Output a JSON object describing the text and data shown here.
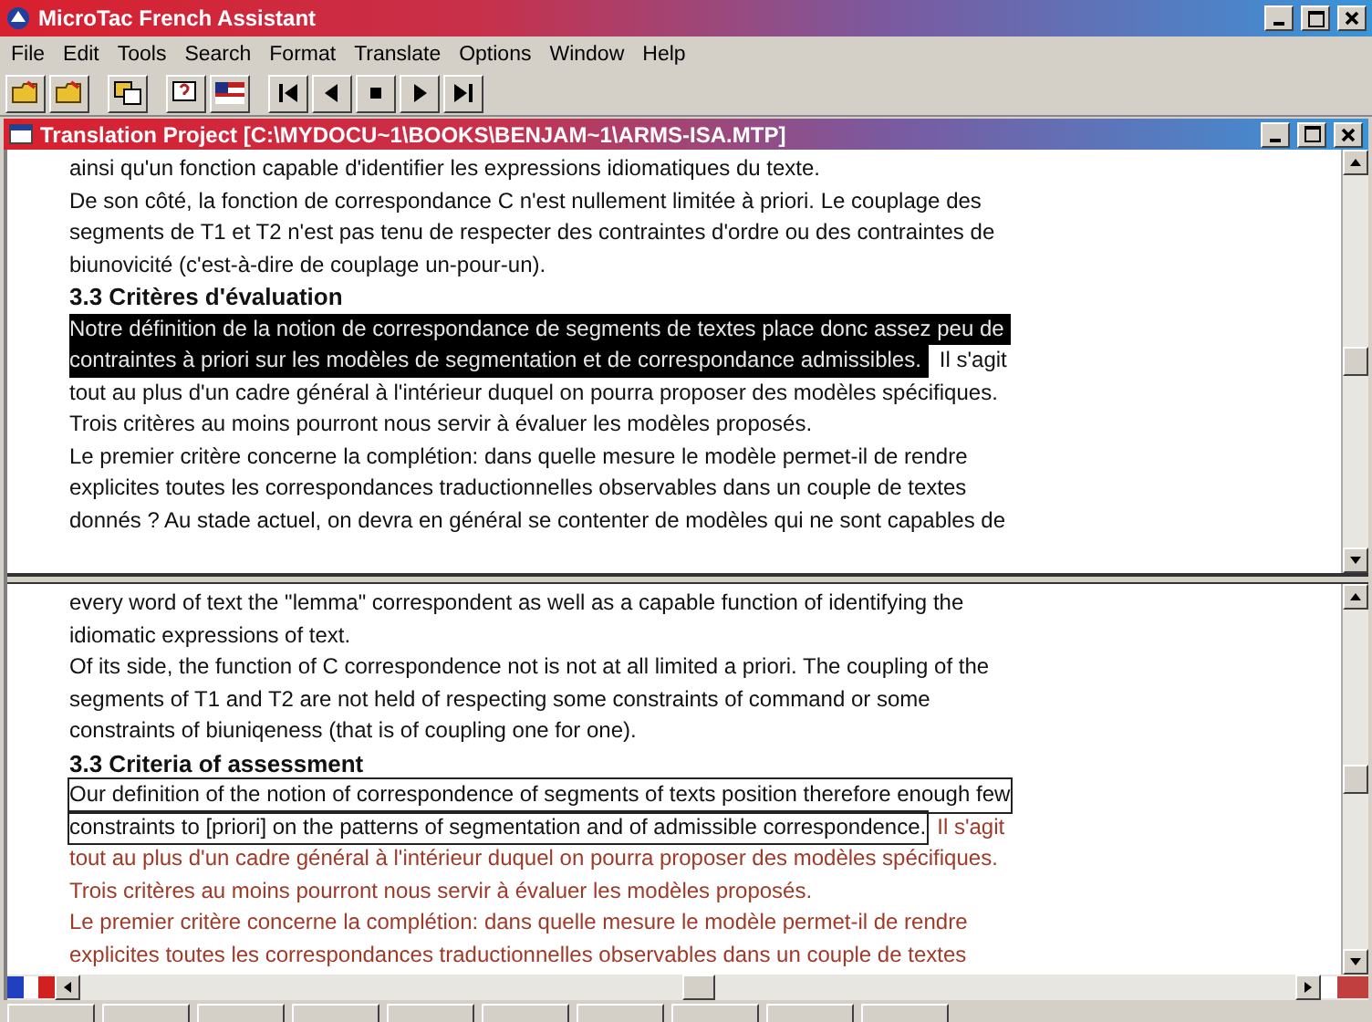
{
  "window": {
    "title": "MicroTac French Assistant"
  },
  "menu": [
    {
      "label": "File"
    },
    {
      "label": "Edit"
    },
    {
      "label": "Tools"
    },
    {
      "label": "Search"
    },
    {
      "label": "Format"
    },
    {
      "label": "Translate"
    },
    {
      "label": "Options"
    },
    {
      "label": "Window"
    },
    {
      "label": "Help"
    }
  ],
  "document": {
    "title": "Translation Project [C:\\MYDOCU~1\\BOOKS\\BENJAM~1\\ARMS-ISA.MTP]"
  },
  "source_pane": {
    "lines": [
      [
        {
          "kind": "normal",
          "text": "ainsi qu'un fonction capable d'identifier les expressions idiomatiques du texte."
        }
      ],
      [
        {
          "kind": "normal",
          "text": "De son côté, la fonction de correspondance C n'est nullement limitée à priori. Le couplage des"
        }
      ],
      [
        {
          "kind": "normal",
          "text": "segments de T1 et T2 n'est pas tenu de respecter des contraintes d'ordre ou des contraintes de"
        }
      ],
      [
        {
          "kind": "normal",
          "text": "biunovicité (c'est-à-dire de couplage un-pour-un)."
        }
      ],
      [
        {
          "kind": "heading",
          "text": "3.3 Critères d'évaluation"
        }
      ],
      [
        {
          "kind": "selected",
          "text": "Notre définition de la notion de correspondance de segments de textes place donc assez peu de"
        }
      ],
      [
        {
          "kind": "selected",
          "text": "contraintes à priori sur les modèles de segmentation et de correspondance admissibles."
        },
        {
          "kind": "normal",
          "text": "Il s'agit"
        }
      ],
      [
        {
          "kind": "normal",
          "text": "tout au plus d'un cadre général à l'intérieur duquel on pourra proposer des modèles spécifiques."
        }
      ],
      [
        {
          "kind": "normal",
          "text": "Trois critères au moins pourront nous servir à évaluer les modèles proposés."
        }
      ],
      [
        {
          "kind": "normal",
          "text": "Le premier critère concerne la complétion: dans quelle mesure le modèle permet-il de rendre"
        }
      ],
      [
        {
          "kind": "normal",
          "text": "explicites toutes les correspondances traductionnelles observables dans un couple de textes"
        }
      ],
      [
        {
          "kind": "normal",
          "text": "donnés ? Au stade actuel, on devra en général se contenter de modèles qui ne sont capables de"
        }
      ]
    ]
  },
  "target_pane": {
    "lines": [
      [
        {
          "kind": "normal",
          "text": "every word of text the \"lemma\" correspondent as well as a capable function of identifying the"
        }
      ],
      [
        {
          "kind": "normal",
          "text": "idiomatic expressions of text."
        }
      ],
      [
        {
          "kind": "normal",
          "text": "Of its side, the function of C correspondence not is not at all limited a priori. The coupling of the"
        }
      ],
      [
        {
          "kind": "normal",
          "text": "segments of T1 and T2 are not held of respecting some constraints of command or some"
        }
      ],
      [
        {
          "kind": "normal",
          "text": "constraints of biuniqeness (that is of coupling one for one)."
        }
      ],
      [
        {
          "kind": "heading",
          "text": "3.3 Criteria of assessment"
        }
      ],
      [
        {
          "kind": "boxed",
          "text": "Our definition of the notion of correspondence of segments of texts position therefore enough few"
        }
      ],
      [
        {
          "kind": "boxed",
          "text": "constraints to [priori] on the patterns of segmentation and of admissible correspondence."
        },
        {
          "kind": "pending",
          "text": "Il s'agit"
        }
      ],
      [
        {
          "kind": "pending",
          "text": "tout au plus d'un cadre général à l'intérieur duquel on pourra proposer des modèles spécifiques."
        }
      ],
      [
        {
          "kind": "pending",
          "text": "Trois critères au moins pourront nous servir à évaluer les modèles proposés."
        }
      ],
      [
        {
          "kind": "pending",
          "text": "Le premier critère concerne la complétion: dans quelle mesure le modèle permet-il de rendre"
        }
      ],
      [
        {
          "kind": "pending",
          "text": "explicites toutes les correspondances traductionnelles observables dans un couple de textes"
        }
      ]
    ]
  }
}
